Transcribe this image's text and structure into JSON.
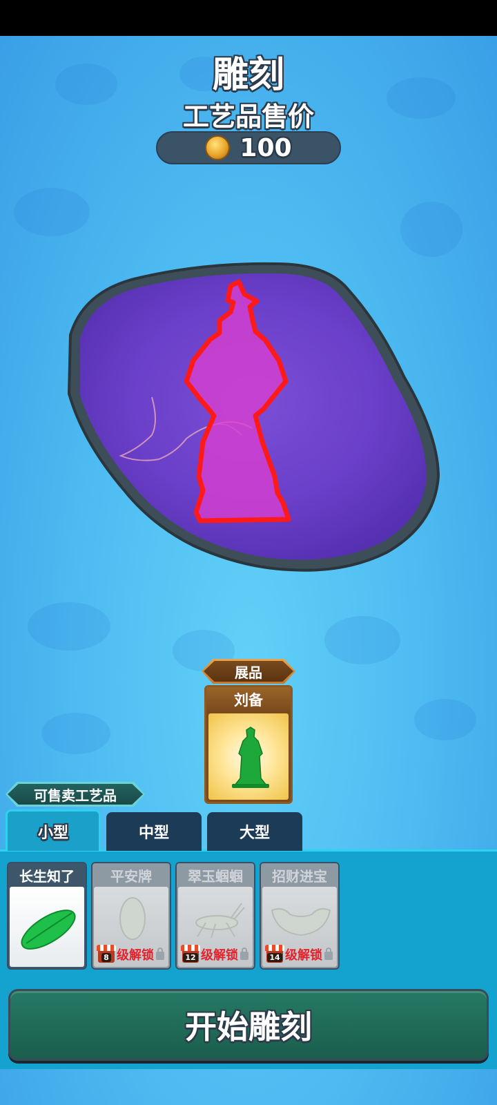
{
  "header": {
    "title": "雕刻",
    "subtitle": "工艺品售价",
    "price": "100",
    "price_icon": "coin-icon"
  },
  "exhibit": {
    "ribbon_label": "展品",
    "name": "刘备"
  },
  "sellable": {
    "label": "可售卖工艺品",
    "tabs": [
      {
        "label": "小型",
        "active": true
      },
      {
        "label": "中型",
        "active": false
      },
      {
        "label": "大型",
        "active": false
      }
    ],
    "items": [
      {
        "name": "长生知了",
        "locked": false
      },
      {
        "name": "平安牌",
        "locked": true,
        "level": "8",
        "unlock_text": "级解锁"
      },
      {
        "name": "翠玉蝈蝈",
        "locked": true,
        "level": "12",
        "unlock_text": "级解锁"
      },
      {
        "name": "招财进宝",
        "locked": true,
        "level": "14",
        "unlock_text": "级解锁"
      }
    ]
  },
  "actions": {
    "start_label": "开始雕刻"
  },
  "colors": {
    "stone_purple": "#6a3fc9",
    "carve_outline": "#ff1a1a",
    "carve_fill": "#d83fd0",
    "button_green": "#1f6b57",
    "tray_blue": "#14a3cf"
  }
}
